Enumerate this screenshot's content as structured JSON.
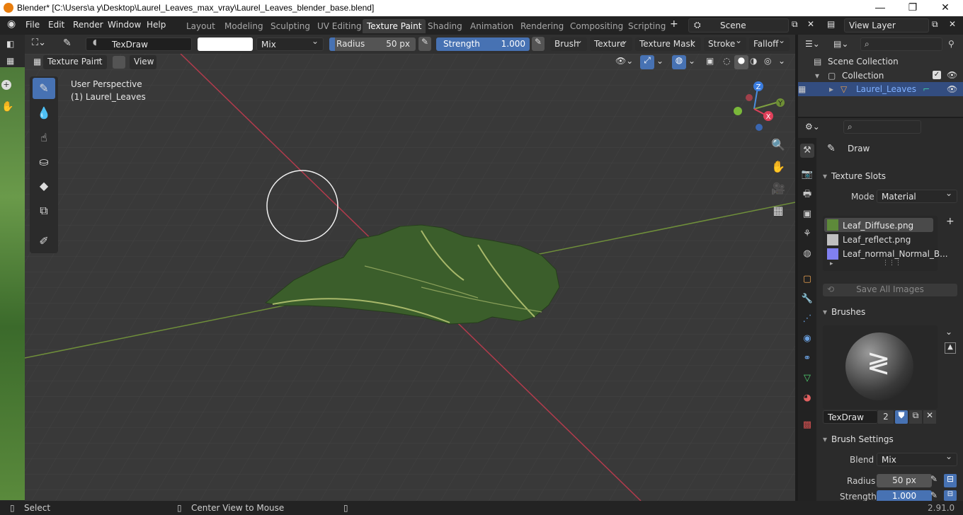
{
  "window": {
    "title": "Blender* [C:\\Users\\a y\\Desktop\\Laurel_Leaves_max_vray\\Laurel_Leaves_blender_base.blend]"
  },
  "menu": [
    "File",
    "Edit",
    "Render",
    "Window",
    "Help"
  ],
  "workspaces": [
    "Layout",
    "Modeling",
    "Sculpting",
    "UV Editing",
    "Texture Paint",
    "Shading",
    "Animation",
    "Rendering",
    "Compositing",
    "Scripting"
  ],
  "active_workspace": "Texture Paint",
  "scene": {
    "label": "Scene",
    "view_layer": "View Layer"
  },
  "tool_header": {
    "brush_name": "TexDraw",
    "blend": "Mix",
    "radius_label": "Radius",
    "radius_value": "50 px",
    "strength_label": "Strength",
    "strength_value": "1.000",
    "menus": [
      "Brush",
      "Texture",
      "Texture Mask",
      "Stroke",
      "Falloff"
    ]
  },
  "mode_header": {
    "mode": "Texture Paint",
    "view": "View"
  },
  "viewport": {
    "perspective": "User Perspective",
    "object": "(1) Laurel_Leaves"
  },
  "gizmo": {
    "x": "X",
    "y": "Y",
    "z": "Z"
  },
  "outliner": {
    "scene_collection": "Scene Collection",
    "collection": "Collection",
    "object": "Laurel_Leaves"
  },
  "properties": {
    "tool_name": "Draw",
    "texture_slots": {
      "title": "Texture Slots",
      "mode_label": "Mode",
      "mode_value": "Material",
      "slots": [
        "Leaf_Diffuse.png",
        "Leaf_reflect.png",
        "Leaf_normal_Normal_B..."
      ],
      "save_all": "Save All Images"
    },
    "brushes": {
      "title": "Brushes",
      "brush": "TexDraw",
      "users": "2"
    },
    "brush_settings": {
      "title": "Brush Settings",
      "blend_label": "Blend",
      "blend_value": "Mix",
      "radius_label": "Radius",
      "radius_value": "50 px",
      "strength_label": "Strength",
      "strength_value": "1.000"
    }
  },
  "statusbar": {
    "select": "Select",
    "center": "Center View to Mouse",
    "version": "2.91.0"
  },
  "colors": {
    "accent": "#4772b3",
    "x_axis": "#c0405a",
    "y_axis": "#7ea040",
    "leaf": "#3b5e2b"
  }
}
